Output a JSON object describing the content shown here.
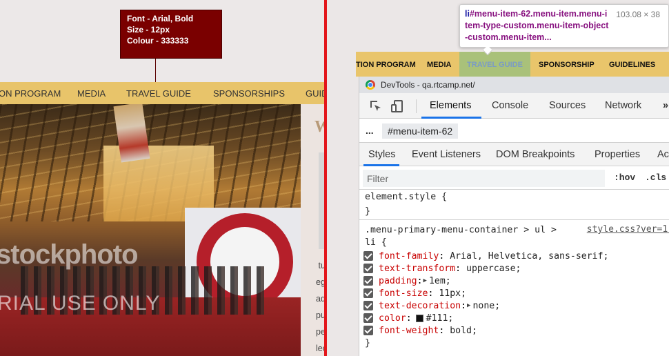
{
  "mockup": {
    "annotation": {
      "line1": "Font - Arial, Bold",
      "line2": "Size - 12px",
      "line3": "Colour - 333333"
    },
    "nav": [
      "ON PROGRAM",
      "MEDIA",
      "TRAVEL GUIDE",
      "SPONSORSHIPS",
      "GUIDELINES"
    ],
    "watermark": {
      "line1": "stockphoto",
      "line2": "RIAL USE ONLY"
    },
    "welcome": "Welco",
    "paragraph": [
      " turpis au",
      "egestas c",
      "adipiscing",
      "pulvinar n",
      "penatibus",
      "lectus sit,"
    ]
  },
  "live_nav": {
    "items": [
      "TION PROGRAM",
      "MEDIA",
      "TRAVEL GUIDE",
      "SPONSORSHIP",
      "GUIDELINES"
    ]
  },
  "tooltip": {
    "tag": "li",
    "selector": "#menu-item-62.menu-item.menu-item-type-custom.menu-item-object-custom.menu-item...",
    "dimensions": "103.08 × 38"
  },
  "devtools": {
    "title": "DevTools - qa.rtcamp.net/",
    "tabs": [
      "Elements",
      "Console",
      "Sources",
      "Network"
    ],
    "more": "»",
    "breadcrumb_dots": "...",
    "breadcrumb_node": "#menu-item-62",
    "subtabs": [
      "Styles",
      "Event Listeners",
      "DOM Breakpoints",
      "Properties",
      "Ac"
    ],
    "filter_placeholder": "Filter",
    "hov": ":hov",
    "cls": ".cls",
    "element_style": {
      "open": "element.style {",
      "close": "}"
    },
    "rule": {
      "selector_line1": ".menu-primary-menu-container > ul >",
      "selector_line2": "li {",
      "source": "style.css?ver=1:",
      "close": "}",
      "declarations": [
        {
          "prop": "font-family",
          "value": "Arial, Helvetica, sans-serif;",
          "expand": false,
          "swatch": false
        },
        {
          "prop": "text-transform",
          "value": "uppercase;",
          "expand": false,
          "swatch": false
        },
        {
          "prop": "padding",
          "value": "1em;",
          "expand": true,
          "swatch": false
        },
        {
          "prop": "font-size",
          "value": "11px;",
          "expand": false,
          "swatch": false
        },
        {
          "prop": "text-decoration",
          "value": "none;",
          "expand": true,
          "swatch": false
        },
        {
          "prop": "color",
          "value": "#111;",
          "expand": false,
          "swatch": true
        },
        {
          "prop": "font-weight",
          "value": "bold;",
          "expand": false,
          "swatch": false
        }
      ]
    }
  },
  "colors": {
    "nav": "#e8c46a",
    "annotation": "#7a0000",
    "divider": "#e3161b",
    "accent": "#1a73e8",
    "css_property": "#c80000"
  }
}
